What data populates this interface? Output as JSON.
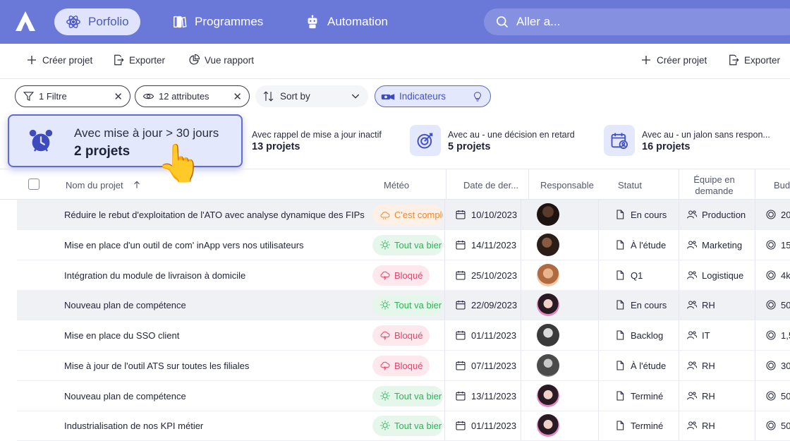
{
  "nav": {
    "items": [
      {
        "label": "Porfolio",
        "active": true
      },
      {
        "label": "Programmes",
        "active": false
      },
      {
        "label": "Automation",
        "active": false
      }
    ],
    "search_placeholder": "Aller a..."
  },
  "toolbar": {
    "create_label": "Créer projet",
    "export_label": "Exporter",
    "report_label": "Vue rapport",
    "create_label_right": "Créer projet",
    "export_label_right": "Exporter"
  },
  "filters": {
    "filter_chip": "1 Filtre",
    "attributes_chip": "12 attributes",
    "sort_label": "Sort by",
    "indicators_label": "Indicateurs"
  },
  "kpis": [
    {
      "title": "Avec mise à jour > 30 jours",
      "value": "2 projets",
      "selected": true,
      "icon": "alarm-clock-icon"
    },
    {
      "title": "Avec rappel de mise a jour inactif",
      "value": "13 projets",
      "icon": "none"
    },
    {
      "title": "Avec au - une décision en retard",
      "value": "5 projets",
      "icon": "target-icon"
    },
    {
      "title": "Avec au - un jalon sans respon...",
      "value": "16 projets",
      "icon": "calendar-user-icon"
    }
  ],
  "table": {
    "headers": {
      "name": "Nom du projet",
      "meteo": "Météo",
      "date": "Date de  der...",
      "owner": "Responsable",
      "status": "Statut",
      "team_line1": "Équipe en",
      "team_line2": "demande",
      "budget": "Budg"
    },
    "rows": [
      {
        "name": "Réduire le rebut d'exploitation de l'ATO avec analyse dynamique des FIPs",
        "meteo": "C'est compli",
        "meteo_type": "warn",
        "date": "10/10/2023",
        "status": "En cours",
        "team": "Production",
        "budget": "20",
        "highlight": true
      },
      {
        "name": "Mise en place d'un outil de com' inApp vers nos utilisateurs",
        "meteo": "Tout va bier",
        "meteo_type": "ok",
        "date": "14/11/2023",
        "status": "À l'étude",
        "team": "Marketing",
        "budget": "15k",
        "highlight": false
      },
      {
        "name": "Intégration du module de livraison à domicile",
        "meteo": "Bloqué",
        "meteo_type": "block",
        "date": "25/10/2023",
        "status": "Q1",
        "team": "Logistique",
        "budget": "4k",
        "highlight": false
      },
      {
        "name": "Nouveau plan de compétence",
        "meteo": "Tout va bier",
        "meteo_type": "ok",
        "date": "22/09/2023",
        "status": "En cours",
        "team": "RH",
        "budget": "50",
        "highlight": true
      },
      {
        "name": "Mise en place du SSO client",
        "meteo": "Bloqué",
        "meteo_type": "block",
        "date": "01/11/2023",
        "status": "Backlog",
        "team": "IT",
        "budget": "1,5",
        "highlight": false
      },
      {
        "name": "Mise à jour de l'outil ATS sur toutes les filiales",
        "meteo": "Bloqué",
        "meteo_type": "block",
        "date": "07/11/2023",
        "status": "À l'étude",
        "team": "RH",
        "budget": "30",
        "highlight": false
      },
      {
        "name": "Nouveau plan de compétence",
        "meteo": "Tout va bier",
        "meteo_type": "ok",
        "date": "13/11/2023",
        "status": "Terminé",
        "team": "RH",
        "budget": "50",
        "highlight": false
      },
      {
        "name": "Industrialisation de nos KPI métier",
        "meteo": "Tout va bier",
        "meteo_type": "ok",
        "date": "01/11/2023",
        "status": "Terminé",
        "team": "RH",
        "budget": "50",
        "highlight": false
      }
    ]
  },
  "colors": {
    "nav_bg": "#6a78d8",
    "accent": "#5965d4",
    "warn": "#f0882e",
    "ok": "#2db356",
    "block": "#e4456c"
  }
}
